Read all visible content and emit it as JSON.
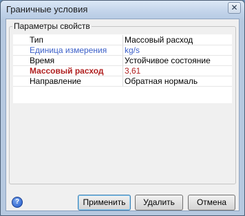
{
  "window": {
    "title": "Граничные условия",
    "close_glyph": "✕"
  },
  "group": {
    "label": "Параметры свойств"
  },
  "properties": [
    {
      "name": "Тип",
      "value": "Массовый расход",
      "style": "normal"
    },
    {
      "name": "Единица измерения",
      "value": "kg/s",
      "style": "blue"
    },
    {
      "name": "Время",
      "value": "Устойчивое состояние",
      "style": "normal"
    },
    {
      "name": "Массовый расход",
      "value": "3,61",
      "style": "red"
    },
    {
      "name": "Направление",
      "value": "Обратная нормаль",
      "style": "normal"
    }
  ],
  "buttons": {
    "help": "?",
    "apply": "Применить",
    "delete": "Удалить",
    "cancel": "Отмена"
  },
  "colors": {
    "accent_blue": "#3b5fc8",
    "highlight_red": "#b02020"
  }
}
